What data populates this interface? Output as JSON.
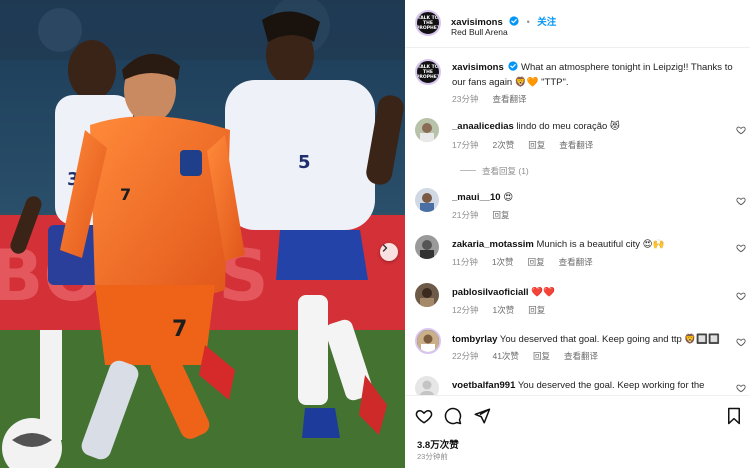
{
  "post": {
    "username": "xavisimons",
    "follow_label": "关注",
    "location": "Red Bull Arena",
    "avatar_logo": "TALK TO THE PROPHET",
    "caption": {
      "username": "xavisimons",
      "text": "What an atmosphere tonight in Leipzig!! Thanks to our fans again 🦁🧡 \"TTP\".",
      "time": "23分钟",
      "translate": "查看翻译"
    },
    "photo": {
      "jersey_numbers": [
        "7",
        "5",
        "33"
      ]
    }
  },
  "comments": [
    {
      "username": "_anaalicedias",
      "text": "lindo do meu coração 😻",
      "time": "17分钟",
      "likes": "2次赞",
      "reply": "回复",
      "translate": "查看翻译",
      "view_replies": "查看回复 (1)"
    },
    {
      "username": "_maui__10",
      "text": "😍",
      "time": "21分钟",
      "likes": "",
      "reply": "回复",
      "translate": "",
      "view_replies": ""
    },
    {
      "username": "zakaria_motassim",
      "text": "Munich is a beautiful city 😍🙌",
      "time": "11分钟",
      "likes": "1次赞",
      "reply": "回复",
      "translate": "查看翻译",
      "view_replies": ""
    },
    {
      "username": "pablosilvaoficiall",
      "text": "❤️❤️",
      "time": "12分钟",
      "likes": "1次赞",
      "reply": "回复",
      "translate": "",
      "view_replies": ""
    },
    {
      "username": "tombyrlay",
      "text": "You deserved that goal. Keep going and ttp 🦁🔲🔲",
      "time": "22分钟",
      "likes": "41次赞",
      "reply": "回复",
      "translate": "查看翻译",
      "view_replies": ""
    },
    {
      "username": "voetbalfan991",
      "text": "You deserved the goal. Keep working for the",
      "time": "",
      "likes": "",
      "reply": "",
      "translate": "",
      "view_replies": ""
    }
  ],
  "footer": {
    "likes": "3.8万次赞",
    "time_ago": "23分钟前"
  },
  "colors": {
    "accent_blue": "#0095f6",
    "verified_blue": "#0095f6",
    "meta_gray": "#8e8e8e",
    "orange_kit": "#f26b1d",
    "france_kit": "#eef1f7"
  }
}
